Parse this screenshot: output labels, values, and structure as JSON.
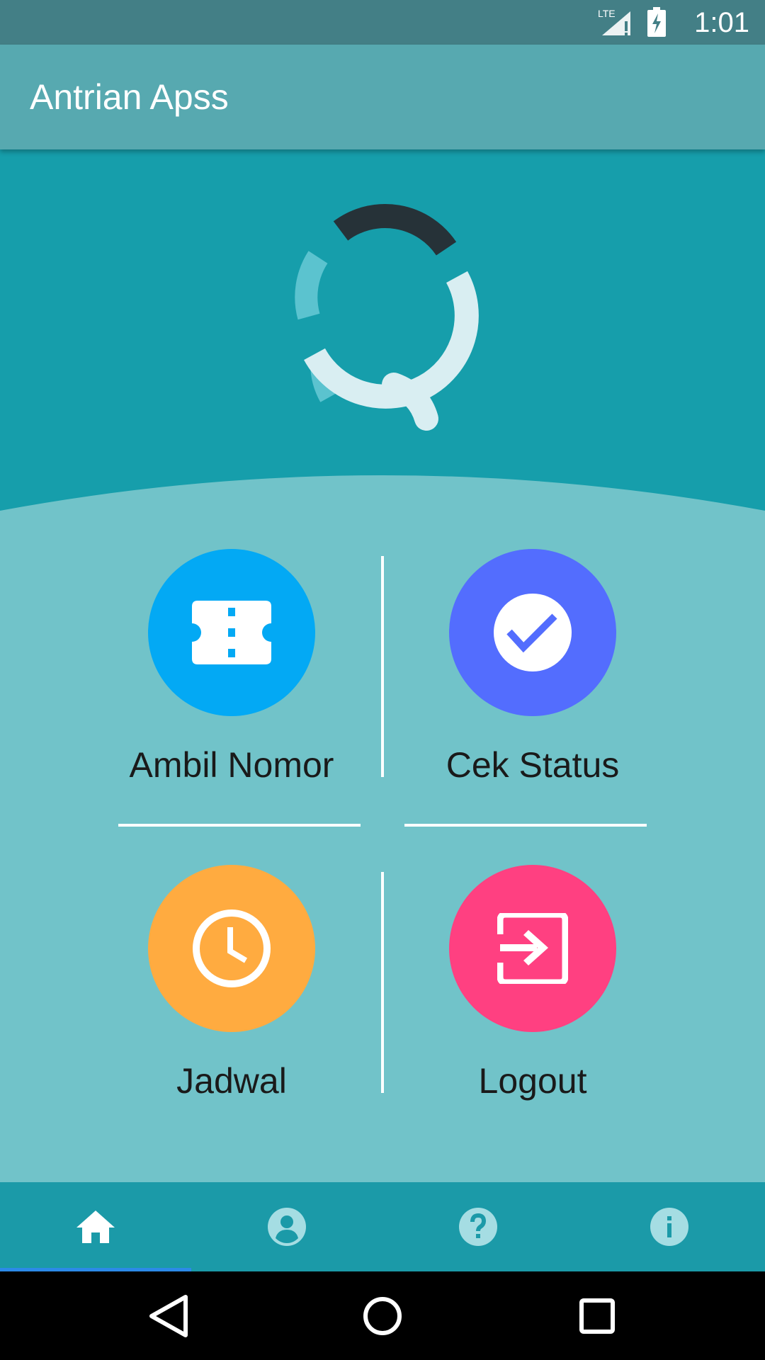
{
  "status_bar": {
    "time": "1:01",
    "network": "LTE",
    "icons": [
      "signal-icon",
      "battery-charging-icon"
    ]
  },
  "app_bar": {
    "title": "Antrian Apss"
  },
  "menu": {
    "items": [
      {
        "label": "Ambil Nomor",
        "icon": "ticket-icon",
        "color": "#03a9f4"
      },
      {
        "label": "Cek Status",
        "icon": "check-circle-icon",
        "color": "#536dfe"
      },
      {
        "label": "Jadwal",
        "icon": "clock-icon",
        "color": "#ffab40"
      },
      {
        "label": "Logout",
        "icon": "logout-icon",
        "color": "#ff4081"
      }
    ]
  },
  "bottom_nav": {
    "items": [
      {
        "icon": "home-icon",
        "selected": true
      },
      {
        "icon": "account-icon",
        "selected": false
      },
      {
        "icon": "help-icon",
        "selected": false
      },
      {
        "icon": "info-icon",
        "selected": false
      }
    ]
  },
  "colors": {
    "status_bar": "#437f86",
    "app_bar": "#57a9b0",
    "hero": "#169eab",
    "content": "#71c3c9",
    "bottom_nav": "#1b9aa8",
    "nav_indicator": "#2c8ae8"
  }
}
